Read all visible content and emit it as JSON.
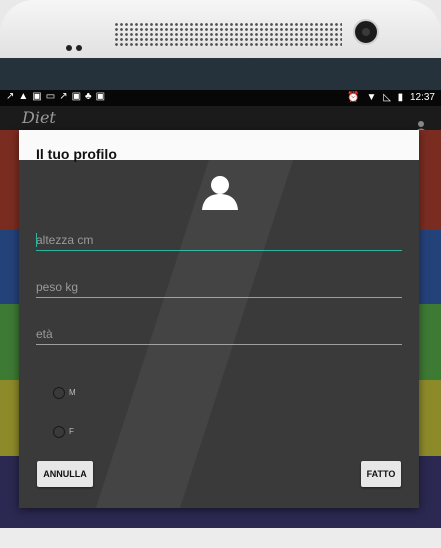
{
  "status_bar": {
    "time": "12:37",
    "left_icons": [
      "missed-call-icon",
      "warning-icon",
      "image-icon",
      "keyboard-icon",
      "missed-call-icon",
      "image-icon",
      "android-icon",
      "image-icon"
    ],
    "right_icons": [
      "alarm-icon",
      "wifi-icon",
      "signal-icon",
      "battery-icon"
    ]
  },
  "app": {
    "logo": "Diet"
  },
  "dialog": {
    "title": "Il tuo profilo",
    "fields": {
      "height_placeholder": "altezza cm",
      "weight_placeholder": "peso kg",
      "age_placeholder": "età"
    },
    "gender": {
      "male_label": "M",
      "female_label": "F"
    },
    "buttons": {
      "cancel": "ANNULLA",
      "done": "FATTO"
    }
  },
  "colors": {
    "accent": "#2bb5a0",
    "bands": [
      "#7b2c21",
      "#24427a",
      "#3d7a34",
      "#8d8a2a",
      "#2b2851"
    ]
  }
}
